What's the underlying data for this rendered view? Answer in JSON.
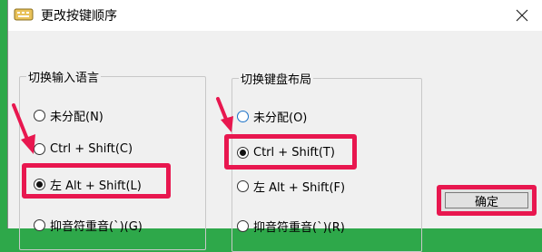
{
  "window": {
    "title": "更改按键顺序"
  },
  "input_language": {
    "title": "切换输入语言",
    "options": [
      {
        "label": "未分配(N)",
        "checked": false
      },
      {
        "label": "Ctrl + Shift(C)",
        "checked": false
      },
      {
        "label": "左 Alt + Shift(L)",
        "checked": true
      },
      {
        "label": "抑音符重音(`)(G)",
        "checked": false
      }
    ]
  },
  "keyboard_layout": {
    "title": "切换键盘布局",
    "options": [
      {
        "label": "未分配(O)",
        "checked": false
      },
      {
        "label": "Ctrl + Shift(T)",
        "checked": true
      },
      {
        "label": "左 Alt + Shift(F)",
        "checked": false
      },
      {
        "label": "抑音符重音(`)(R)",
        "checked": false
      }
    ]
  },
  "buttons": {
    "ok": "确定"
  },
  "colors": {
    "highlight": "#e8174f",
    "background_outside": "#2ea84a",
    "dialog": "#f0f0f0"
  }
}
